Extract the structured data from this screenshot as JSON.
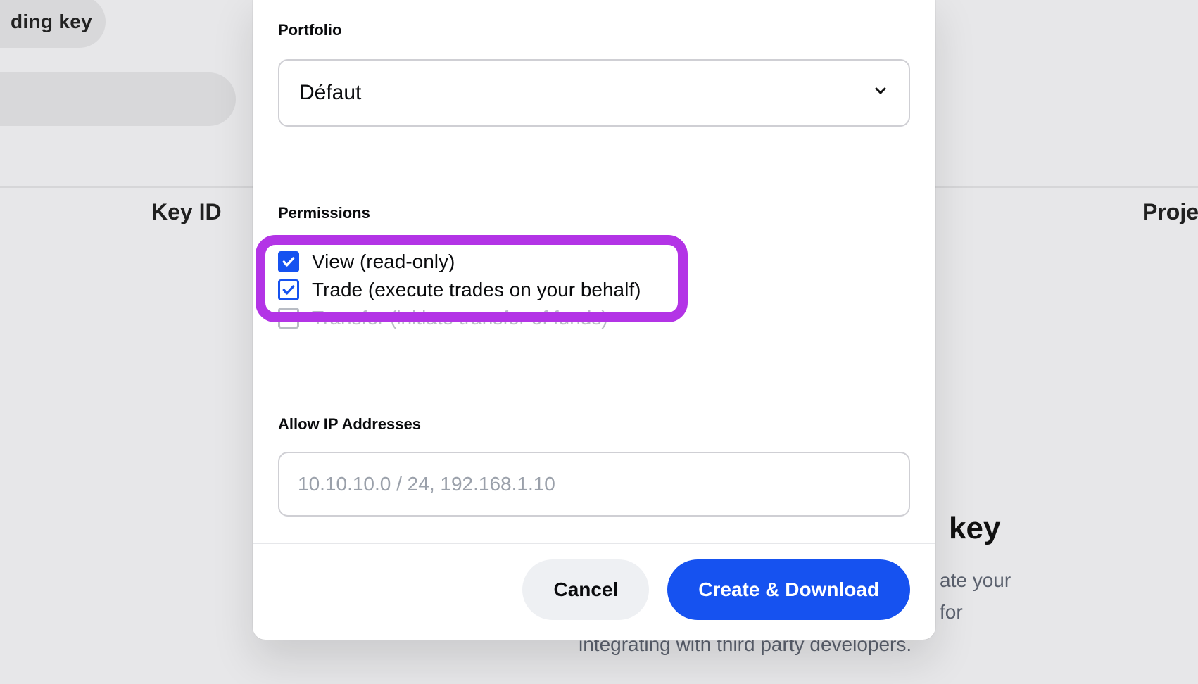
{
  "background": {
    "pill_label": "ding key",
    "col_key_id": "Key ID",
    "col_project": "Project",
    "heading_fragment": "key",
    "line1": "ate your",
    "line2": "for",
    "line3": "integrating with third party developers."
  },
  "modal": {
    "portfolio": {
      "label": "Portfolio",
      "selected": "Défaut"
    },
    "permissions": {
      "label": "Permissions",
      "items": [
        {
          "label": "View (read-only)",
          "checked": true,
          "style": "filled"
        },
        {
          "label": "Trade (execute trades on your behalf)",
          "checked": true,
          "style": "outline"
        },
        {
          "label": "Transfer (initiate transfer of funds)",
          "checked": false,
          "style": "grey"
        }
      ]
    },
    "allow_ips": {
      "label": "Allow IP Addresses",
      "placeholder": "10.10.10.0 / 24, 192.168.1.10",
      "value": ""
    },
    "buttons": {
      "cancel": "Cancel",
      "create": "Create & Download"
    }
  }
}
